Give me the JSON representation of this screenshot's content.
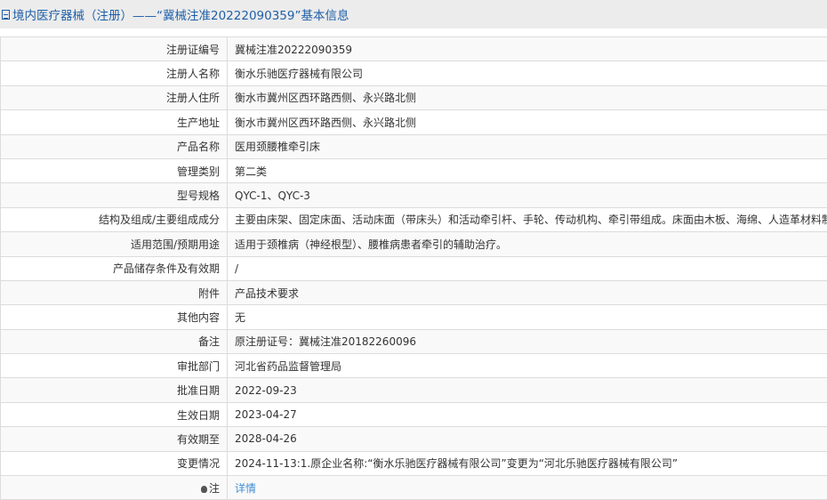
{
  "header": {
    "icon": "document-icon",
    "title": "境内医疗器械（注册）——“冀械注准20222090359”基本信息"
  },
  "rows": [
    {
      "label": "注册证编号",
      "value": "冀械注准20222090359"
    },
    {
      "label": "注册人名称",
      "value": "衡水乐驰医疗器械有限公司"
    },
    {
      "label": "注册人住所",
      "value": "衡水市冀州区西环路西侧、永兴路北侧"
    },
    {
      "label": "生产地址",
      "value": "衡水市冀州区西环路西侧、永兴路北侧"
    },
    {
      "label": "产品名称",
      "value": "医用颈腰椎牵引床"
    },
    {
      "label": "管理类别",
      "value": "第二类"
    },
    {
      "label": "型号规格",
      "value": "QYC-1、QYC-3"
    },
    {
      "label": "结构及组成/主要组成成分",
      "value": "主要由床架、固定床面、活动床面（带床头）和活动牵引杆、手轮、传动机构、牵引带组成。床面由木板、海绵、人造革材料制成。"
    },
    {
      "label": "适用范围/预期用途",
      "value": "适用于颈椎病（神经根型）、腰椎病患者牵引的辅助治疗。"
    },
    {
      "label": "产品储存条件及有效期",
      "value": "/"
    },
    {
      "label": "附件",
      "value": "产品技术要求"
    },
    {
      "label": "其他内容",
      "value": "无"
    },
    {
      "label": "备注",
      "value": "原注册证号：冀械注准20182260096"
    },
    {
      "label": "审批部门",
      "value": "河北省药品监督管理局"
    },
    {
      "label": "批准日期",
      "value": "2022-09-23"
    },
    {
      "label": "生效日期",
      "value": "2023-04-27"
    },
    {
      "label": "有效期至",
      "value": "2028-04-26"
    },
    {
      "label": "变更情况",
      "value": "2024-11-13:1.原企业名称:“衡水乐驰医疗器械有限公司”变更为“河北乐驰医疗器械有限公司”"
    }
  ],
  "note": {
    "icon": "bulb-icon",
    "label": "注",
    "link": "详情"
  }
}
